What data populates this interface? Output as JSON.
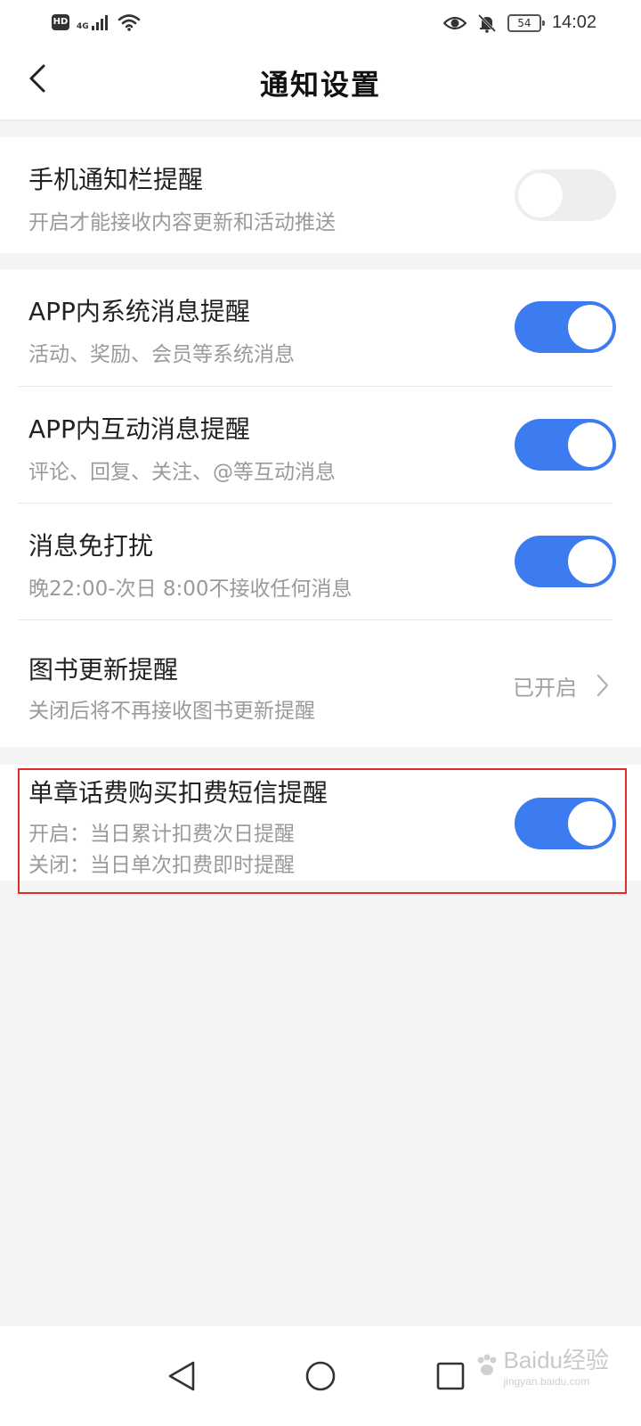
{
  "status_bar": {
    "hd": "HD",
    "network": "4G",
    "battery": "54",
    "time": "14:02",
    "icons": [
      "signal-icon",
      "wifi-icon",
      "eye-icon",
      "bell-off-icon",
      "battery-icon"
    ]
  },
  "header": {
    "title": "通知设置",
    "back_icon": "chevron-left-icon"
  },
  "settings": {
    "phone_notify": {
      "title": "手机通知栏提醒",
      "subtitle": "开启才能接收内容更新和活动推送",
      "enabled": false
    },
    "system_msg": {
      "title": "APP内系统消息提醒",
      "subtitle": "活动、奖励、会员等系统消息",
      "enabled": true
    },
    "interact_msg": {
      "title": "APP内互动消息提醒",
      "subtitle": "评论、回复、关注、@等互动消息",
      "enabled": true
    },
    "dnd": {
      "title": "消息免打扰",
      "subtitle": "晚22:00-次日 8:00不接收任何消息",
      "enabled": true
    },
    "book_update": {
      "title": "图书更新提醒",
      "subtitle": "关闭后将不再接收图书更新提醒",
      "status": "已开启"
    },
    "sms_charge": {
      "title": "单章话费购买扣费短信提醒",
      "subtitle_line1": "开启：当日累计扣费次日提醒",
      "subtitle_line2": "关闭：当日单次扣费即时提醒",
      "enabled": true
    }
  },
  "colors": {
    "toggle_on": "#3d7bf0",
    "toggle_off": "#eeeeee",
    "highlight": "#e02b2b",
    "background": "#f4f4f4"
  },
  "navbar": {
    "icons": [
      "nav-back-icon",
      "nav-home-icon",
      "nav-recents-icon"
    ]
  },
  "watermark": {
    "text": "Baidu经验",
    "sub": "jingyan.baidu.com"
  }
}
